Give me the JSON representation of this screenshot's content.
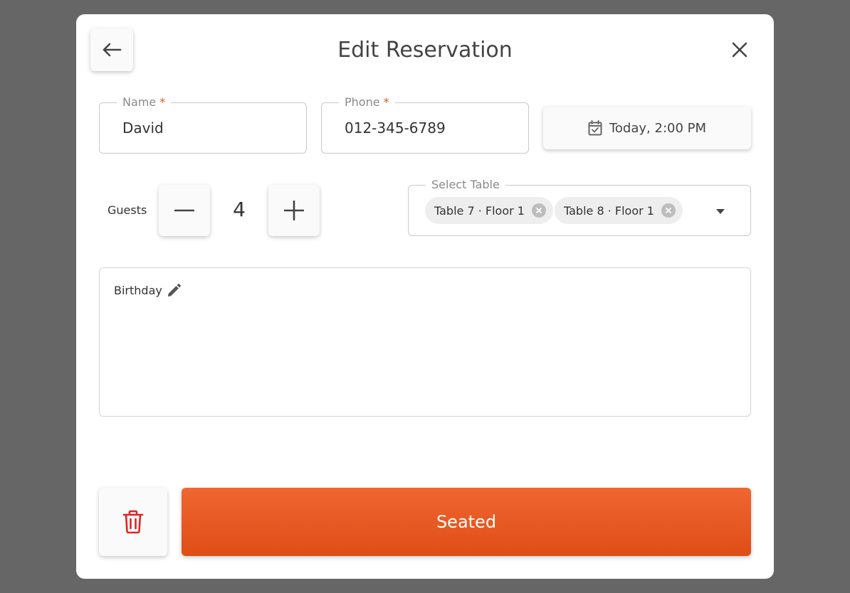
{
  "header": {
    "title": "Edit Reservation",
    "back_icon": "arrow-left-icon",
    "close_icon": "close-icon"
  },
  "form": {
    "name": {
      "label": "Name",
      "required_marker": "*",
      "value": "David"
    },
    "phone": {
      "label": "Phone",
      "required_marker": "*",
      "value": "012-345-6789"
    },
    "datetime": {
      "icon": "calendar-icon",
      "value": "Today, 2:00 PM"
    },
    "guests": {
      "label": "Guests",
      "count": "4",
      "decrement_icon": "minus-icon",
      "increment_icon": "plus-icon"
    },
    "table_select": {
      "label": "Select Table",
      "selected": [
        {
          "label": "Table 7 · Floor 1"
        },
        {
          "label": "Table 8 · Floor 1"
        }
      ],
      "caret_icon": "caret-down-icon"
    },
    "notes": {
      "value": "Birthday",
      "edit_icon": "pencil-icon"
    }
  },
  "footer": {
    "delete_icon": "trash-icon",
    "primary_label": "Seated"
  },
  "colors": {
    "accent": "#e8561f",
    "danger": "#e02424",
    "overlay": "#666666"
  }
}
